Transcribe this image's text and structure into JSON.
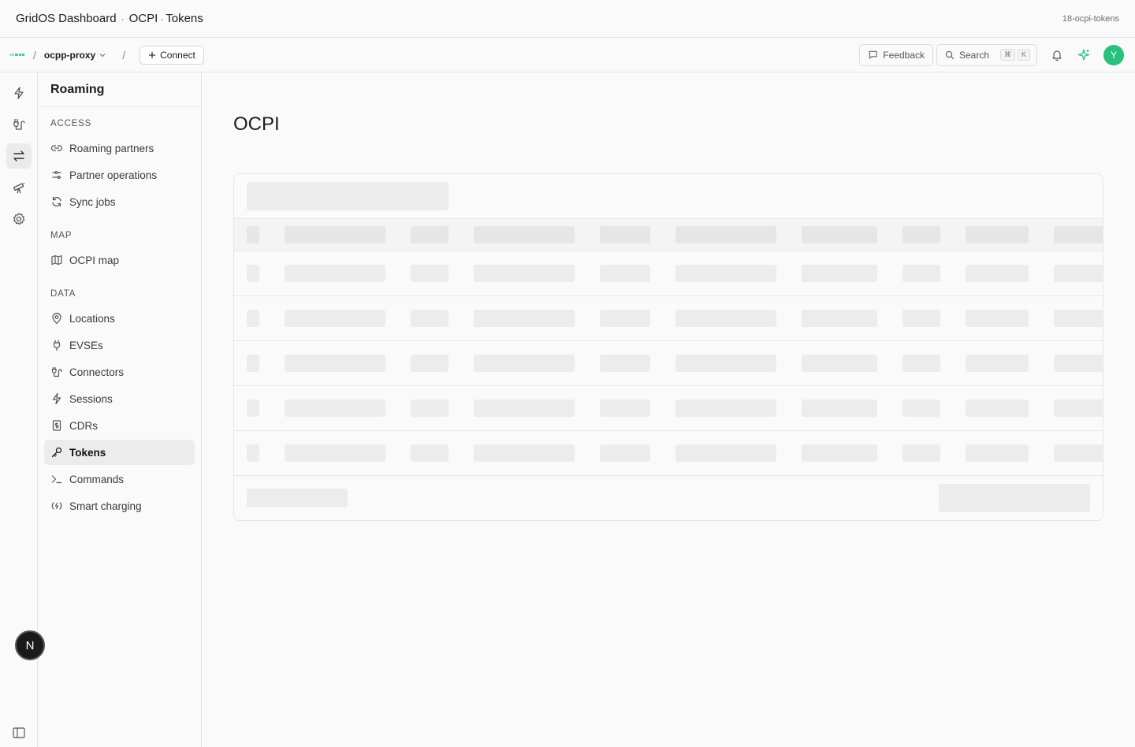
{
  "titlebar": {
    "app": "GridOS Dashboard",
    "section": "OCPI",
    "page": "Tokens",
    "separator": "·",
    "id": "18-ocpi-tokens"
  },
  "topnav": {
    "project": "ocpp-proxy",
    "connect_label": "Connect",
    "feedback_label": "Feedback",
    "search_label": "Search",
    "search_kbd": [
      "⌘",
      "K"
    ],
    "avatar_initial": "Y",
    "brand_color": "#3ecf8e"
  },
  "menu": {
    "title": "Roaming",
    "sections": [
      {
        "title": "ACCESS",
        "items": [
          "Roaming partners",
          "Partner operations",
          "Sync jobs"
        ]
      },
      {
        "title": "MAP",
        "items": [
          "OCPI map"
        ]
      },
      {
        "title": "DATA",
        "items": [
          "Locations",
          "EVSEs",
          "Connectors",
          "Sessions",
          "CDRs",
          "Tokens",
          "Commands",
          "Smart charging"
        ]
      }
    ],
    "active_item": "Tokens"
  },
  "main": {
    "title": "OCPI",
    "table_state": "loading"
  },
  "bottom_badge": "N"
}
